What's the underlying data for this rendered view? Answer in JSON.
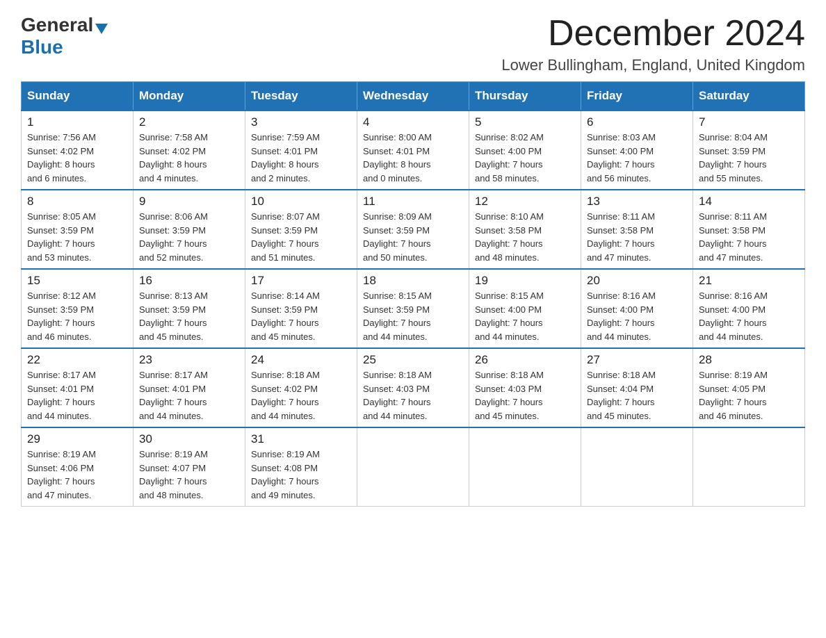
{
  "logo": {
    "general": "General",
    "blue": "Blue"
  },
  "title": "December 2024",
  "location": "Lower Bullingham, England, United Kingdom",
  "weekdays": [
    "Sunday",
    "Monday",
    "Tuesday",
    "Wednesday",
    "Thursday",
    "Friday",
    "Saturday"
  ],
  "weeks": [
    [
      {
        "day": "1",
        "sunrise": "7:56 AM",
        "sunset": "4:02 PM",
        "daylight": "8 hours and 6 minutes."
      },
      {
        "day": "2",
        "sunrise": "7:58 AM",
        "sunset": "4:02 PM",
        "daylight": "8 hours and 4 minutes."
      },
      {
        "day": "3",
        "sunrise": "7:59 AM",
        "sunset": "4:01 PM",
        "daylight": "8 hours and 2 minutes."
      },
      {
        "day": "4",
        "sunrise": "8:00 AM",
        "sunset": "4:01 PM",
        "daylight": "8 hours and 0 minutes."
      },
      {
        "day": "5",
        "sunrise": "8:02 AM",
        "sunset": "4:00 PM",
        "daylight": "7 hours and 58 minutes."
      },
      {
        "day": "6",
        "sunrise": "8:03 AM",
        "sunset": "4:00 PM",
        "daylight": "7 hours and 56 minutes."
      },
      {
        "day": "7",
        "sunrise": "8:04 AM",
        "sunset": "3:59 PM",
        "daylight": "7 hours and 55 minutes."
      }
    ],
    [
      {
        "day": "8",
        "sunrise": "8:05 AM",
        "sunset": "3:59 PM",
        "daylight": "7 hours and 53 minutes."
      },
      {
        "day": "9",
        "sunrise": "8:06 AM",
        "sunset": "3:59 PM",
        "daylight": "7 hours and 52 minutes."
      },
      {
        "day": "10",
        "sunrise": "8:07 AM",
        "sunset": "3:59 PM",
        "daylight": "7 hours and 51 minutes."
      },
      {
        "day": "11",
        "sunrise": "8:09 AM",
        "sunset": "3:59 PM",
        "daylight": "7 hours and 50 minutes."
      },
      {
        "day": "12",
        "sunrise": "8:10 AM",
        "sunset": "3:58 PM",
        "daylight": "7 hours and 48 minutes."
      },
      {
        "day": "13",
        "sunrise": "8:11 AM",
        "sunset": "3:58 PM",
        "daylight": "7 hours and 47 minutes."
      },
      {
        "day": "14",
        "sunrise": "8:11 AM",
        "sunset": "3:58 PM",
        "daylight": "7 hours and 47 minutes."
      }
    ],
    [
      {
        "day": "15",
        "sunrise": "8:12 AM",
        "sunset": "3:59 PM",
        "daylight": "7 hours and 46 minutes."
      },
      {
        "day": "16",
        "sunrise": "8:13 AM",
        "sunset": "3:59 PM",
        "daylight": "7 hours and 45 minutes."
      },
      {
        "day": "17",
        "sunrise": "8:14 AM",
        "sunset": "3:59 PM",
        "daylight": "7 hours and 45 minutes."
      },
      {
        "day": "18",
        "sunrise": "8:15 AM",
        "sunset": "3:59 PM",
        "daylight": "7 hours and 44 minutes."
      },
      {
        "day": "19",
        "sunrise": "8:15 AM",
        "sunset": "4:00 PM",
        "daylight": "7 hours and 44 minutes."
      },
      {
        "day": "20",
        "sunrise": "8:16 AM",
        "sunset": "4:00 PM",
        "daylight": "7 hours and 44 minutes."
      },
      {
        "day": "21",
        "sunrise": "8:16 AM",
        "sunset": "4:00 PM",
        "daylight": "7 hours and 44 minutes."
      }
    ],
    [
      {
        "day": "22",
        "sunrise": "8:17 AM",
        "sunset": "4:01 PM",
        "daylight": "7 hours and 44 minutes."
      },
      {
        "day": "23",
        "sunrise": "8:17 AM",
        "sunset": "4:01 PM",
        "daylight": "7 hours and 44 minutes."
      },
      {
        "day": "24",
        "sunrise": "8:18 AM",
        "sunset": "4:02 PM",
        "daylight": "7 hours and 44 minutes."
      },
      {
        "day": "25",
        "sunrise": "8:18 AM",
        "sunset": "4:03 PM",
        "daylight": "7 hours and 44 minutes."
      },
      {
        "day": "26",
        "sunrise": "8:18 AM",
        "sunset": "4:03 PM",
        "daylight": "7 hours and 45 minutes."
      },
      {
        "day": "27",
        "sunrise": "8:18 AM",
        "sunset": "4:04 PM",
        "daylight": "7 hours and 45 minutes."
      },
      {
        "day": "28",
        "sunrise": "8:19 AM",
        "sunset": "4:05 PM",
        "daylight": "7 hours and 46 minutes."
      }
    ],
    [
      {
        "day": "29",
        "sunrise": "8:19 AM",
        "sunset": "4:06 PM",
        "daylight": "7 hours and 47 minutes."
      },
      {
        "day": "30",
        "sunrise": "8:19 AM",
        "sunset": "4:07 PM",
        "daylight": "7 hours and 48 minutes."
      },
      {
        "day": "31",
        "sunrise": "8:19 AM",
        "sunset": "4:08 PM",
        "daylight": "7 hours and 49 minutes."
      },
      null,
      null,
      null,
      null
    ]
  ],
  "labels": {
    "sunrise": "Sunrise:",
    "sunset": "Sunset:",
    "daylight": "Daylight:"
  }
}
